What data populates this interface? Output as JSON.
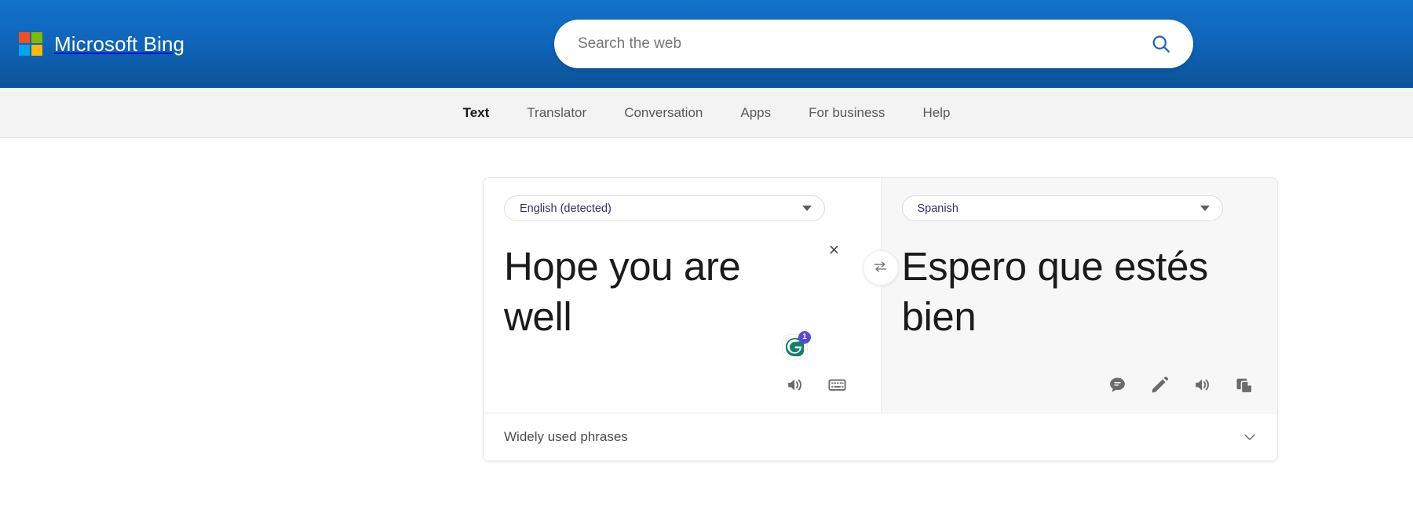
{
  "header": {
    "brand": "Microsoft Bing",
    "logo_colors": {
      "top_left": "#f25022",
      "top_right": "#7fba00",
      "bottom_left": "#00a4ef",
      "bottom_right": "#ffb900"
    },
    "background_gradient": [
      "#1272ca",
      "#0c5398"
    ],
    "search": {
      "placeholder": "Search the web",
      "value": "",
      "icon": "search-icon",
      "icon_color": "#1b66b3"
    }
  },
  "nav": {
    "items": [
      {
        "label": "Text",
        "active": true
      },
      {
        "label": "Translator",
        "active": false
      },
      {
        "label": "Conversation",
        "active": false
      },
      {
        "label": "Apps",
        "active": false
      },
      {
        "label": "For business",
        "active": false
      },
      {
        "label": "Help",
        "active": false
      }
    ]
  },
  "translator": {
    "source": {
      "language": "English (detected)",
      "text": "Hope you are well",
      "clear_label": "×",
      "grammarly": {
        "icon": "grammarly-icon",
        "badge_count": "1",
        "badge_color": "#5a49d6",
        "logo_color": "#15806a"
      },
      "tools": [
        {
          "name": "listen-source-icon",
          "label": "Listen"
        },
        {
          "name": "keyboard-icon",
          "label": "Keyboard"
        }
      ]
    },
    "swap": {
      "name": "swap-languages-icon",
      "label": "Swap languages"
    },
    "target": {
      "language": "Spanish",
      "text": "Espero que estés bien",
      "tools": [
        {
          "name": "feedback-icon",
          "label": "Feedback"
        },
        {
          "name": "edit-icon",
          "label": "Edit"
        },
        {
          "name": "listen-target-icon",
          "label": "Listen"
        },
        {
          "name": "copy-icon",
          "label": "Copy"
        }
      ]
    },
    "footer": {
      "label": "Widely used phrases",
      "chevron": "chevron-down-icon",
      "expanded": false
    }
  }
}
